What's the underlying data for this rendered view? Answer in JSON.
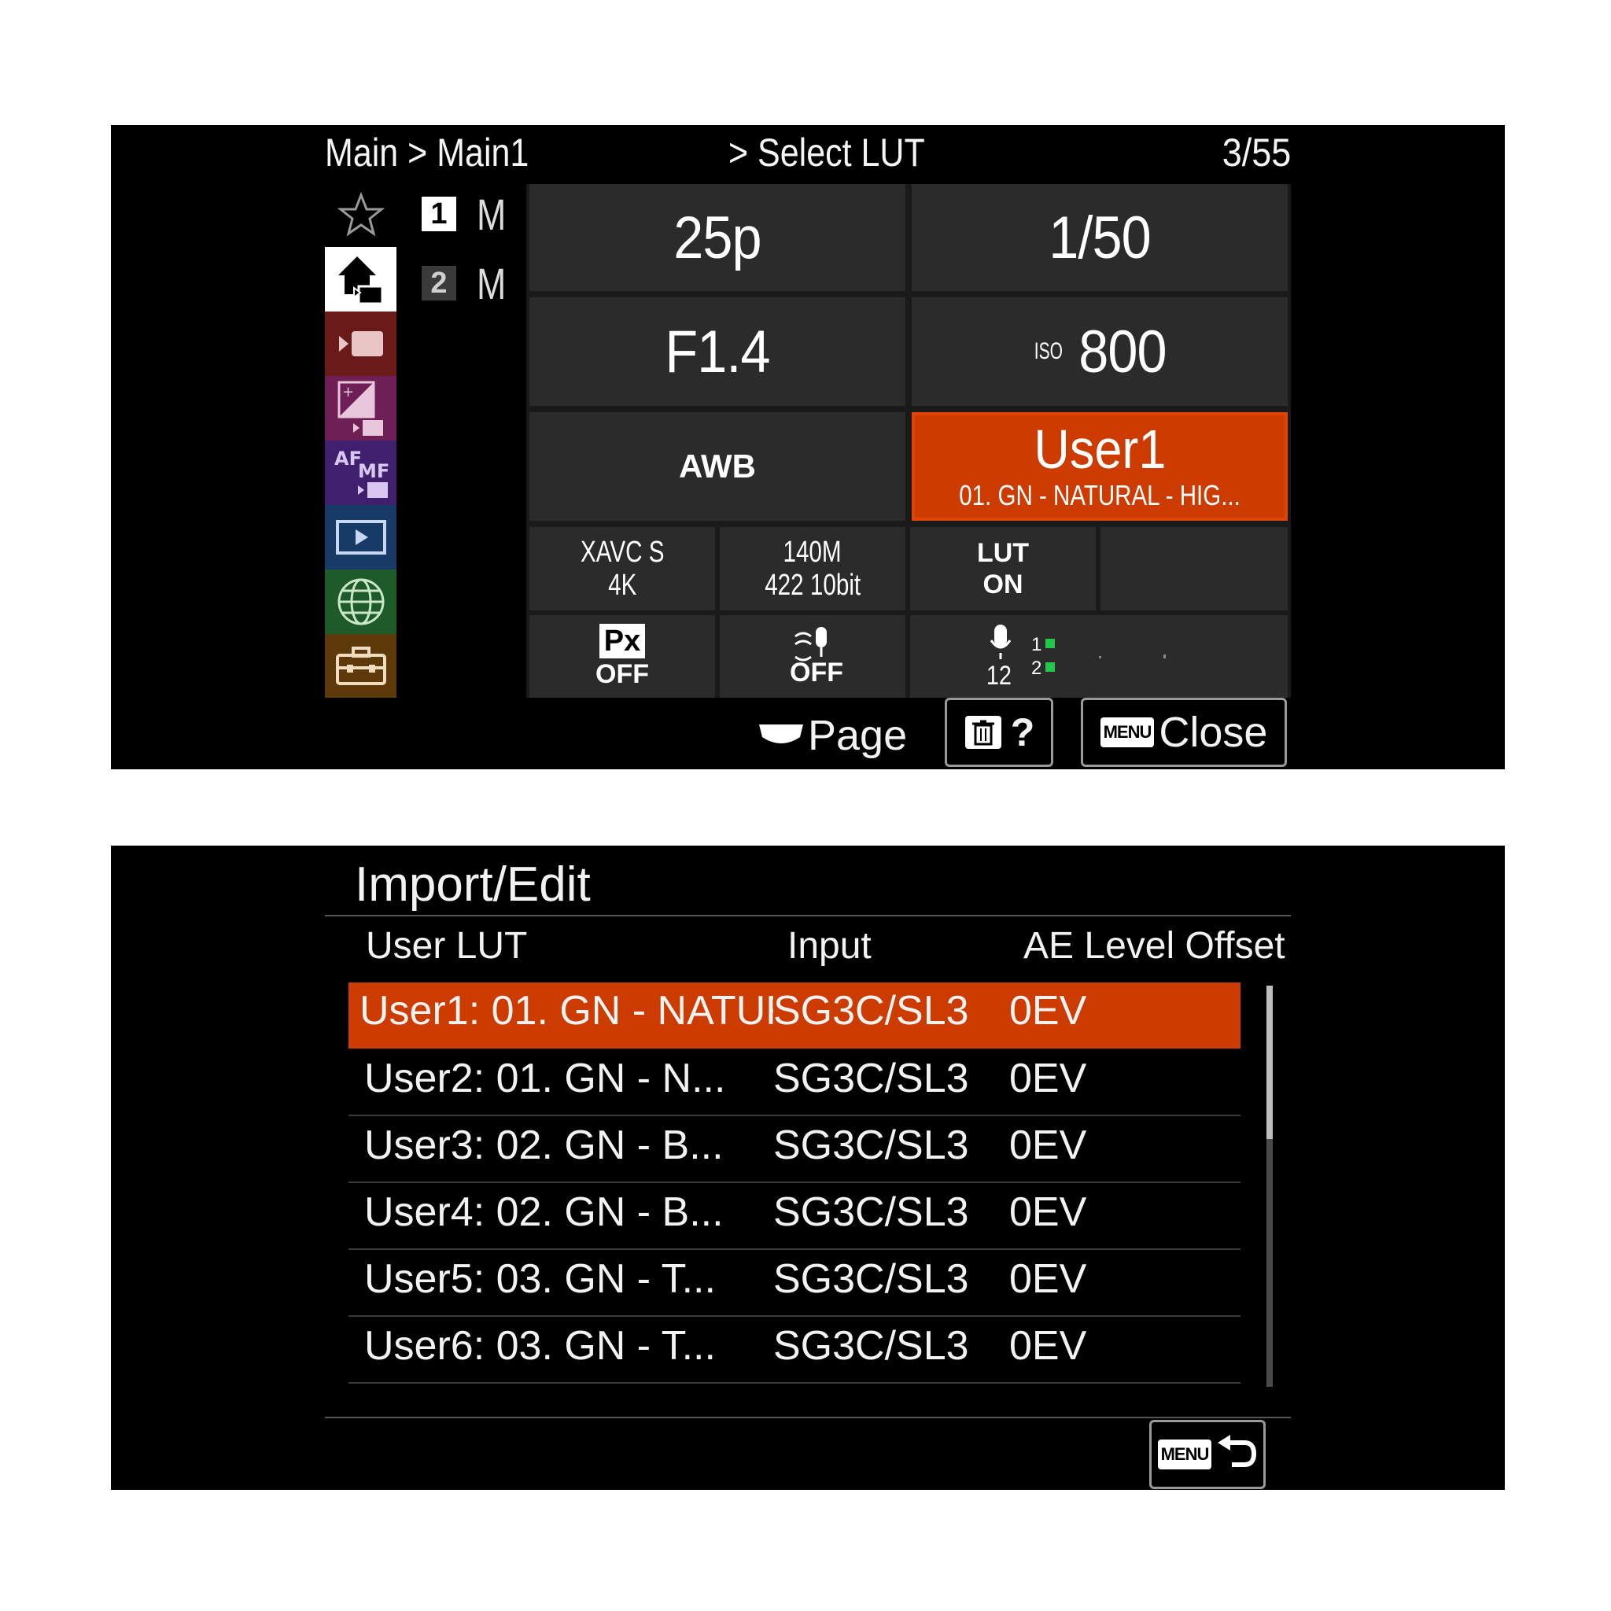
{
  "screen1": {
    "breadcrumb": {
      "path": "Main > Main1",
      "item": "> Select LUT"
    },
    "page_counter": "3/55",
    "sidebar_tabs": [
      {
        "icon": "star-icon",
        "color": "#000000"
      },
      {
        "icon": "home-camera-icon",
        "color": "#ffffff",
        "selected": true
      },
      {
        "icon": "movie-camera-icon",
        "color": "#6b1a1a"
      },
      {
        "icon": "exposure-icon",
        "color": "#6e1f55"
      },
      {
        "icon": "af-mf-icon",
        "color": "#3f1f6e"
      },
      {
        "icon": "playback-icon",
        "color": "#173b66"
      },
      {
        "icon": "globe-icon",
        "color": "#1f5a2a"
      },
      {
        "icon": "toolbox-icon",
        "color": "#5e3a0a"
      }
    ],
    "submenu": [
      {
        "num": "1",
        "letter": "M",
        "active": true
      },
      {
        "num": "2",
        "letter": "M",
        "active": false
      }
    ],
    "cells": {
      "frame_rate": "25p",
      "shutter": "1/50",
      "aperture": "F1.4",
      "iso_label": "ISO",
      "iso_value": "800",
      "white_balance": "AWB",
      "lut_name": "User1",
      "lut_desc": "01. GN - NATURAL - HIG...",
      "format_line1": "XAVC S",
      "format_line2": "4K",
      "bitrate_line1": "140M",
      "bitrate_line2": "422 10bit",
      "lut_status_line1": "LUT",
      "lut_status_line2": "ON",
      "px_label": "Px",
      "px_status": "OFF",
      "wind_status": "OFF",
      "audio_channels": "12",
      "audio_ch1": "1",
      "audio_ch2": "2"
    },
    "footer": {
      "page_label": "Page",
      "help_label": "?",
      "menu_badge": "MENU",
      "close_label": "Close"
    },
    "accent": "#cc3b00"
  },
  "screen2": {
    "title": "Import/Edit",
    "columns": {
      "user_lut": "User LUT",
      "input": "Input",
      "ae_offset": "AE Level Offset"
    },
    "rows": [
      {
        "name": "User1: 01. GN - NATUR",
        "input": "SG3C/SL3",
        "ae": "0EV",
        "selected": true
      },
      {
        "name": "User2: 01. GN - N...",
        "input": "SG3C/SL3",
        "ae": "0EV"
      },
      {
        "name": "User3: 02. GN - B...",
        "input": "SG3C/SL3",
        "ae": "0EV"
      },
      {
        "name": "User4: 02. GN - B...",
        "input": "SG3C/SL3",
        "ae": "0EV"
      },
      {
        "name": "User5: 03. GN - T...",
        "input": "SG3C/SL3",
        "ae": "0EV"
      },
      {
        "name": "User6: 03. GN - T...",
        "input": "SG3C/SL3",
        "ae": "0EV"
      }
    ],
    "back_badge": "MENU"
  }
}
